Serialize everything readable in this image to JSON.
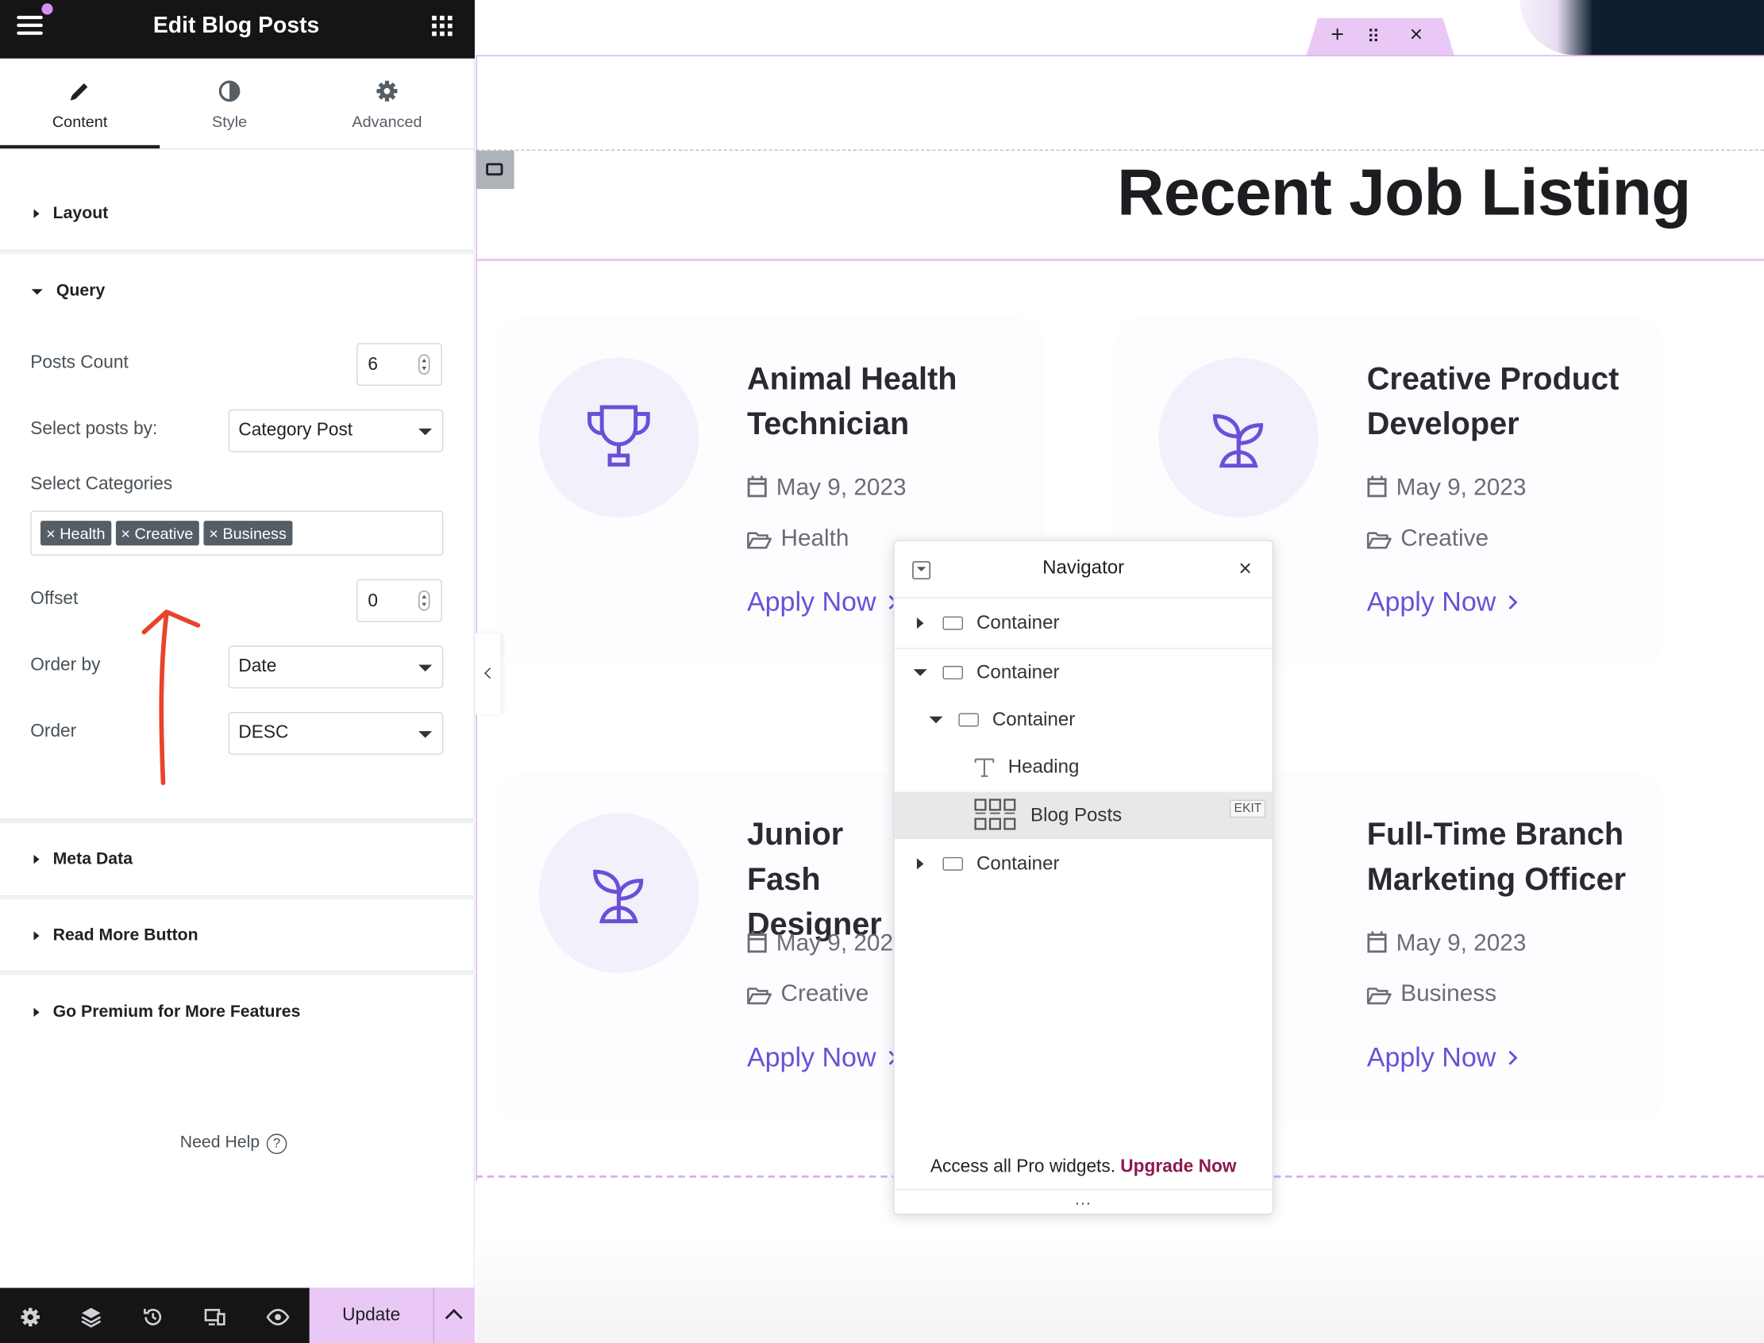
{
  "panel": {
    "title": "Edit Blog Posts",
    "tabs": [
      {
        "label": "Content",
        "icon": "pencil-icon",
        "active": true
      },
      {
        "label": "Style",
        "icon": "contrast-icon",
        "active": false
      },
      {
        "label": "Advanced",
        "icon": "gear-icon",
        "active": false
      }
    ],
    "sections": {
      "layout": "Layout",
      "query": "Query",
      "meta": "Meta Data",
      "read_more": "Read More Button",
      "premium": "Go Premium for More Features"
    },
    "query": {
      "posts_count_label": "Posts Count",
      "posts_count_value": "6",
      "select_by_label": "Select posts by:",
      "select_by_value": "Category Post",
      "categories_label": "Select Categories",
      "categories": [
        "Health",
        "Creative",
        "Business"
      ],
      "offset_label": "Offset",
      "offset_value": "0",
      "order_by_label": "Order by",
      "order_by_value": "Date",
      "order_label": "Order",
      "order_value": "DESC"
    },
    "need_help": "Need Help",
    "update_label": "Update"
  },
  "canvas": {
    "heading": "Recent Job Listing",
    "cards": [
      {
        "title": "Animal Health Technician",
        "date": "May 9, 2023",
        "category": "Health",
        "apply": "Apply Now",
        "icon": "trophy-icon"
      },
      {
        "title": "Creative Product Developer",
        "date": "May 9, 2023",
        "category": "Creative",
        "apply": "Apply Now",
        "icon": "sprout-icon"
      },
      {
        "title": "Junior Fash Designer",
        "date": "May 9, 2023",
        "category": "Creative",
        "apply": "Apply Now",
        "icon": "sprout-icon"
      },
      {
        "title": "Full-Time Branch Marketing Officer",
        "date": "May 9, 2023",
        "category": "Business",
        "apply": "Apply Now",
        "icon": "sprout-icon"
      }
    ]
  },
  "navigator": {
    "title": "Navigator",
    "items": [
      {
        "label": "Container",
        "level": 0,
        "expanded": false
      },
      {
        "label": "Container",
        "level": 0,
        "expanded": true
      },
      {
        "label": "Container",
        "level": 1,
        "expanded": true
      },
      {
        "label": "Heading",
        "level": 2
      },
      {
        "label": "Blog Posts",
        "level": 2,
        "selected": true,
        "badge": "EKIT"
      },
      {
        "label": "Container",
        "level": 0,
        "expanded": false
      }
    ],
    "footer_text": "Access all Pro widgets.",
    "footer_link": "Upgrade Now",
    "more": "..."
  },
  "colors": {
    "accent": "#6b4fd8",
    "update_bg": "#e9c8f6",
    "upgrade": "#8b1a4e",
    "topbar": "#151515"
  }
}
